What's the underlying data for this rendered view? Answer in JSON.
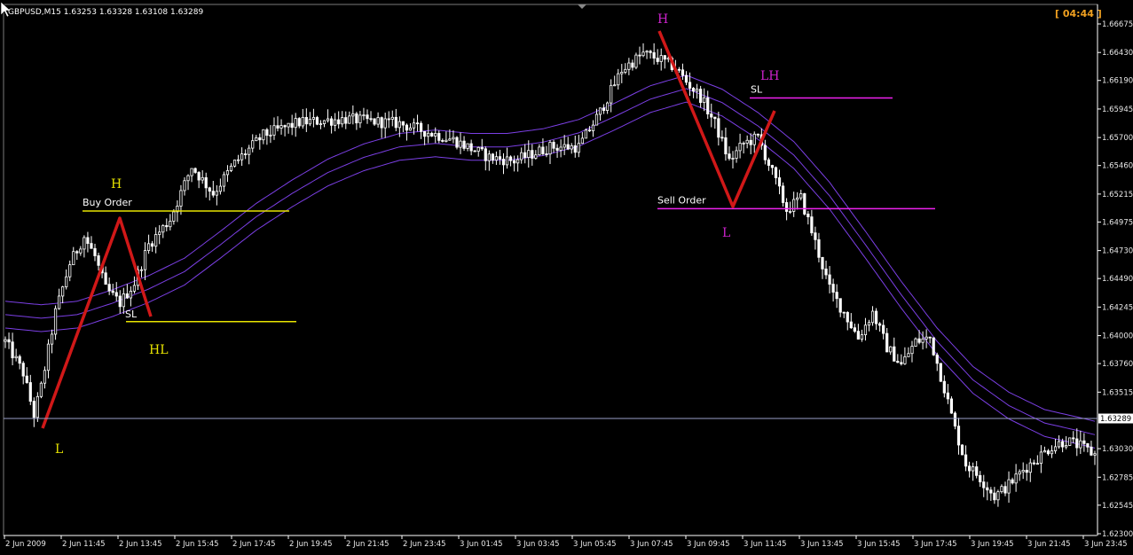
{
  "header": {
    "symbol_info": "GBPUSD,M15  1.63253 1.63328 1.63108 1.63289",
    "timer": "[ 04:44 ]"
  },
  "current_price_label": "1.63289",
  "chart_data": {
    "type": "candlestick",
    "title": "GBPUSD,M15",
    "ohlc_header": {
      "open": 1.63253,
      "high": 1.63328,
      "low": 1.63108,
      "close": 1.63289
    },
    "ylim": [
      1.623,
      1.668
    ],
    "y_ticks": [
      "1.66675",
      "1.66430",
      "1.66190",
      "1.65945",
      "1.65700",
      "1.65460",
      "1.65215",
      "1.64975",
      "1.64730",
      "1.64490",
      "1.64245",
      "1.64000",
      "1.63760",
      "1.63515",
      "1.63289",
      "1.63030",
      "1.62785",
      "1.62545",
      "1.62300"
    ],
    "x_ticks": [
      "2 Jun 2009",
      "2 Jun 11:45",
      "2 Jun 13:45",
      "2 Jun 15:45",
      "2 Jun 17:45",
      "2 Jun 19:45",
      "2 Jun 21:45",
      "2 Jun 23:45",
      "3 Jun 01:45",
      "3 Jun 03:45",
      "3 Jun 05:45",
      "3 Jun 07:45",
      "3 Jun 09:45",
      "3 Jun 11:45",
      "3 Jun 13:45",
      "3 Jun 15:45",
      "3 Jun 17:45",
      "3 Jun 19:45",
      "3 Jun 21:45",
      "3 Jun 23:45"
    ],
    "current_price": 1.63289,
    "close_path": [
      [
        0,
        1.6395
      ],
      [
        5,
        1.6368
      ],
      [
        8,
        1.6332
      ],
      [
        10,
        1.6356
      ],
      [
        14,
        1.642
      ],
      [
        18,
        1.6462
      ],
      [
        22,
        1.6485
      ],
      [
        25,
        1.6468
      ],
      [
        28,
        1.644
      ],
      [
        32,
        1.6428
      ],
      [
        36,
        1.6445
      ],
      [
        40,
        1.6478
      ],
      [
        46,
        1.65
      ],
      [
        52,
        1.6545
      ],
      [
        58,
        1.6522
      ],
      [
        64,
        1.6548
      ],
      [
        72,
        1.6572
      ],
      [
        82,
        1.6583
      ],
      [
        95,
        1.6586
      ],
      [
        110,
        1.6582
      ],
      [
        125,
        1.6568
      ],
      [
        135,
        1.6553
      ],
      [
        142,
        1.655
      ],
      [
        152,
        1.6562
      ],
      [
        160,
        1.6562
      ],
      [
        166,
        1.6592
      ],
      [
        172,
        1.6628
      ],
      [
        178,
        1.6642
      ],
      [
        182,
        1.6638
      ],
      [
        187,
        1.663
      ],
      [
        190,
        1.6618
      ],
      [
        194,
        1.6605
      ],
      [
        198,
        1.6582
      ],
      [
        202,
        1.655
      ],
      [
        206,
        1.6565
      ],
      [
        210,
        1.657
      ],
      [
        214,
        1.654
      ],
      [
        218,
        1.6508
      ],
      [
        222,
        1.6518
      ],
      [
        226,
        1.648
      ],
      [
        230,
        1.644
      ],
      [
        234,
        1.642
      ],
      [
        238,
        1.6398
      ],
      [
        242,
        1.642
      ],
      [
        246,
        1.639
      ],
      [
        250,
        1.6375
      ],
      [
        254,
        1.6395
      ],
      [
        258,
        1.6398
      ],
      [
        262,
        1.6355
      ],
      [
        265,
        1.632
      ],
      [
        268,
        1.629
      ],
      [
        272,
        1.6278
      ],
      [
        276,
        1.6262
      ],
      [
        280,
        1.6272
      ],
      [
        284,
        1.6285
      ],
      [
        288,
        1.6295
      ],
      [
        292,
        1.6305
      ],
      [
        296,
        1.631
      ],
      [
        300,
        1.6305
      ],
      [
        304,
        1.6298
      ]
    ],
    "moving_average_bands": {
      "color": "#7b3fe4",
      "middle": [
        [
          0,
          1.6418
        ],
        [
          10,
          1.6415
        ],
        [
          20,
          1.6418
        ],
        [
          30,
          1.6428
        ],
        [
          40,
          1.644
        ],
        [
          50,
          1.6455
        ],
        [
          60,
          1.6478
        ],
        [
          70,
          1.6502
        ],
        [
          80,
          1.6522
        ],
        [
          90,
          1.654
        ],
        [
          100,
          1.6553
        ],
        [
          110,
          1.6562
        ],
        [
          120,
          1.6565
        ],
        [
          130,
          1.6562
        ],
        [
          140,
          1.6562
        ],
        [
          150,
          1.6566
        ],
        [
          160,
          1.6574
        ],
        [
          170,
          1.6588
        ],
        [
          180,
          1.6603
        ],
        [
          190,
          1.6612
        ],
        [
          200,
          1.66
        ],
        [
          210,
          1.658
        ],
        [
          220,
          1.6555
        ],
        [
          230,
          1.652
        ],
        [
          240,
          1.6478
        ],
        [
          250,
          1.6435
        ],
        [
          260,
          1.6395
        ],
        [
          270,
          1.6362
        ],
        [
          280,
          1.634
        ],
        [
          290,
          1.6325
        ],
        [
          300,
          1.6318
        ],
        [
          304,
          1.6315
        ]
      ],
      "offset": 0.00115
    },
    "annotations": {
      "buy_setup": {
        "H_label": "H",
        "HL_label": "HL",
        "L_label": "L",
        "SL_label": "SL",
        "order_label": "Buy Order",
        "buy_price": 1.6507,
        "sl_price": 1.6412,
        "color": "#e8e400"
      },
      "sell_setup": {
        "H_label": "H",
        "LH_label": "LH",
        "L_label": "L",
        "SL_label": "SL",
        "order_label": "Sell Order",
        "sell_price": 1.6509,
        "sl_price": 1.6604,
        "label_color": "#cc22cc",
        "line_color": "#ee22ee"
      },
      "zigzag_color": "#d01818"
    }
  }
}
